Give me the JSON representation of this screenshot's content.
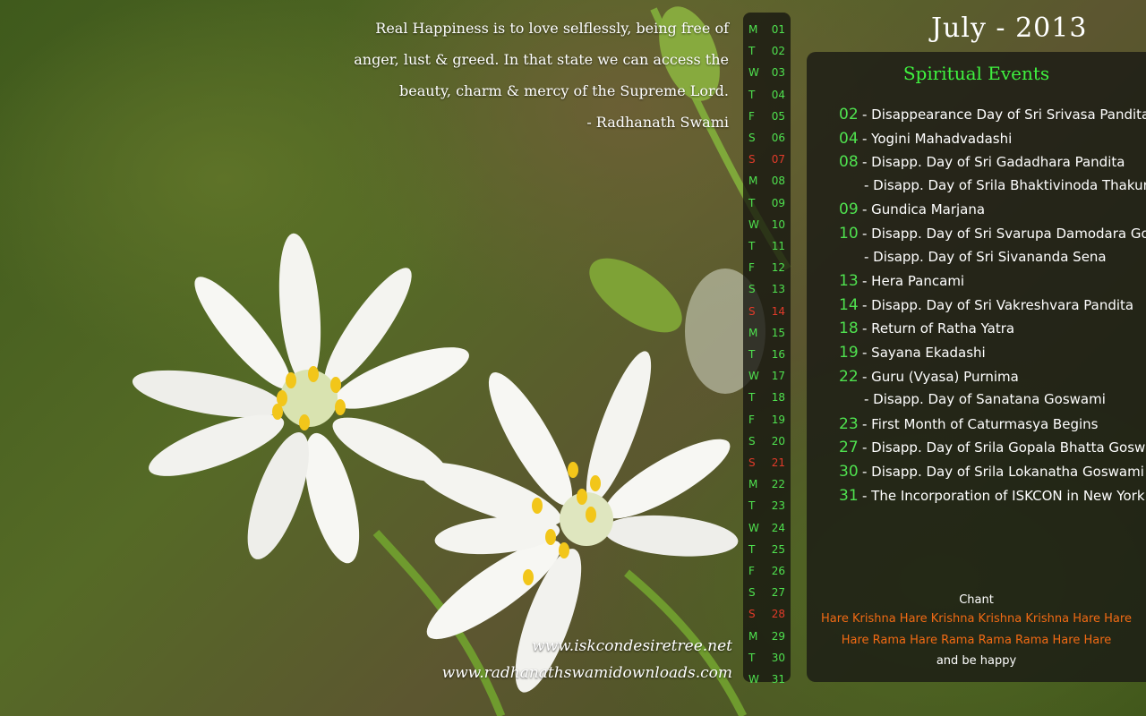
{
  "quote": {
    "lines": [
      "Real Happiness is to love selflessly, being free of",
      "anger, lust & greed. In that state we can access the",
      "beauty, charm & mercy of the Supreme Lord."
    ],
    "author": "- Radhanath Swami"
  },
  "calendar": {
    "month_title": "July - 2013",
    "days": [
      {
        "d": "M",
        "n": "01"
      },
      {
        "d": "T",
        "n": "02"
      },
      {
        "d": "W",
        "n": "03"
      },
      {
        "d": "T",
        "n": "04"
      },
      {
        "d": "F",
        "n": "05"
      },
      {
        "d": "S",
        "n": "06"
      },
      {
        "d": "S",
        "n": "07",
        "sun": true
      },
      {
        "d": "M",
        "n": "08"
      },
      {
        "d": "T",
        "n": "09"
      },
      {
        "d": "W",
        "n": "10"
      },
      {
        "d": "T",
        "n": "11"
      },
      {
        "d": "F",
        "n": "12"
      },
      {
        "d": "S",
        "n": "13"
      },
      {
        "d": "S",
        "n": "14",
        "sun": true
      },
      {
        "d": "M",
        "n": "15"
      },
      {
        "d": "T",
        "n": "16"
      },
      {
        "d": "W",
        "n": "17"
      },
      {
        "d": "T",
        "n": "18"
      },
      {
        "d": "F",
        "n": "19"
      },
      {
        "d": "S",
        "n": "20"
      },
      {
        "d": "S",
        "n": "21",
        "sun": true
      },
      {
        "d": "M",
        "n": "22"
      },
      {
        "d": "T",
        "n": "23"
      },
      {
        "d": "W",
        "n": "24"
      },
      {
        "d": "T",
        "n": "25"
      },
      {
        "d": "F",
        "n": "26"
      },
      {
        "d": "S",
        "n": "27"
      },
      {
        "d": "S",
        "n": "28",
        "sun": true
      },
      {
        "d": "M",
        "n": "29"
      },
      {
        "d": "T",
        "n": "30"
      },
      {
        "d": "W",
        "n": "31"
      }
    ]
  },
  "events_panel": {
    "title": "Spiritual Events",
    "events": [
      {
        "num": "02",
        "text": "- Disappearance Day of Sri Srivasa Pandita"
      },
      {
        "num": "04",
        "text": "- Yogini Mahadvadashi"
      },
      {
        "num": "08",
        "text": "- Disapp. Day of Sri Gadadhara Pandita"
      },
      {
        "num": "",
        "text": "- Disapp. Day of Srila Bhaktivinoda Thakura"
      },
      {
        "num": "09",
        "text": "- Gundica Marjana"
      },
      {
        "num": "10",
        "text": "- Disapp. Day of Sri Svarupa Damodara Gosvami"
      },
      {
        "num": "",
        "text": "- Disapp. Day of Sri Sivananda Sena"
      },
      {
        "num": "13",
        "text": "- Hera Pancami"
      },
      {
        "num": "14",
        "text": "- Disapp. Day of Sri Vakreshvara Pandita"
      },
      {
        "num": "18",
        "text": "- Return of Ratha Yatra"
      },
      {
        "num": "19",
        "text": "- Sayana Ekadashi"
      },
      {
        "num": "22",
        "text": "- Guru (Vyasa) Purnima"
      },
      {
        "num": "",
        "text": "- Disapp. Day of Sanatana Goswami"
      },
      {
        "num": "23",
        "text": "- First Month of Caturmasya Begins"
      },
      {
        "num": "27",
        "text": "- Disapp. Day of Srila Gopala Bhatta Goswami"
      },
      {
        "num": "30",
        "text": "- Disapp. Day of Srila Lokanatha Goswami"
      },
      {
        "num": "31",
        "text": "- The Incorporation of ISKCON in New York"
      }
    ],
    "chant_label": "Chant",
    "mantra_lines": [
      "Hare Krishna Hare Krishna Krishna Krishna Hare Hare",
      "Hare Rama Hare Rama Rama Rama Hare Hare"
    ],
    "closing": "and be happy"
  },
  "websites": [
    "www.iskcondesiretree.net",
    "www.radhanathswamidownloads.com"
  ],
  "colors": {
    "accent_green": "#4fe14f",
    "sunday_red": "#e23b2a",
    "mantra_orange": "#f06a14"
  }
}
